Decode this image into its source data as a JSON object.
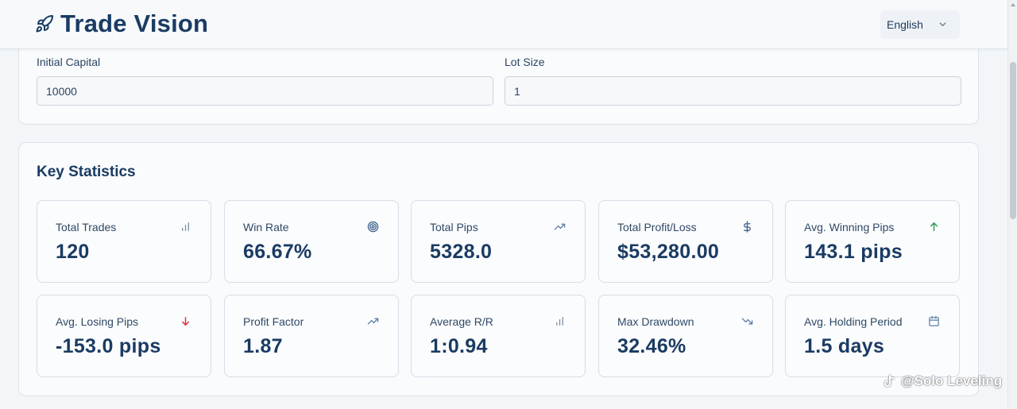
{
  "header": {
    "title": "Trade Vision",
    "brand_icon": "rocket-icon",
    "language": "English"
  },
  "settings": {
    "initial_capital": {
      "label": "Initial Capital",
      "value": "10000"
    },
    "lot_size": {
      "label": "Lot Size",
      "value": "1"
    }
  },
  "stats": {
    "title": "Key Statistics",
    "items": [
      {
        "label": "Total Trades",
        "value": "120",
        "icon": "bar-chart-icon",
        "icon_color": "#7b8fa6"
      },
      {
        "label": "Win Rate",
        "value": "66.67%",
        "icon": "target-icon",
        "icon_color": "#3a5f8a"
      },
      {
        "label": "Total Pips",
        "value": "5328.0",
        "icon": "trending-up-icon",
        "icon_color": "#5b7fa6"
      },
      {
        "label": "Total Profit/Loss",
        "value": "$53,280.00",
        "icon": "dollar-icon",
        "icon_color": "#3a5f8a"
      },
      {
        "label": "Avg. Winning Pips",
        "value": "143.1 pips",
        "icon": "arrow-up-icon",
        "icon_color": "#2e9e5b"
      },
      {
        "label": "Avg. Losing Pips",
        "value": "-153.0 pips",
        "icon": "arrow-down-icon",
        "icon_color": "#d9363e"
      },
      {
        "label": "Profit Factor",
        "value": "1.87",
        "icon": "trending-up-icon",
        "icon_color": "#5b7fa6"
      },
      {
        "label": "Average R/R",
        "value": "1:0.94",
        "icon": "bar-chart-icon",
        "icon_color": "#7b8fa6"
      },
      {
        "label": "Max Drawdown",
        "value": "32.46%",
        "icon": "trending-down-icon",
        "icon_color": "#5b7fa6"
      },
      {
        "label": "Avg. Holding Period",
        "value": "1.5 days",
        "icon": "calendar-icon",
        "icon_color": "#5b7fa6"
      }
    ]
  },
  "watermark": {
    "text": "@Solo Leveling"
  }
}
